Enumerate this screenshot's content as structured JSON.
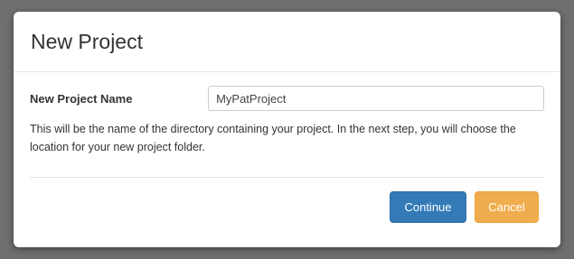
{
  "dialog": {
    "title": "New Project",
    "field_label": "New Project Name",
    "field_value": "MyPatProject",
    "help_text": "This will be the name of the directory containing your project. In the next step, you will choose the location for your new project folder.",
    "continue_label": "Continue",
    "cancel_label": "Cancel"
  },
  "colors": {
    "continue_button": "#337ab7",
    "cancel_button": "#f0ad4e",
    "backdrop": "#6f6f6f"
  }
}
